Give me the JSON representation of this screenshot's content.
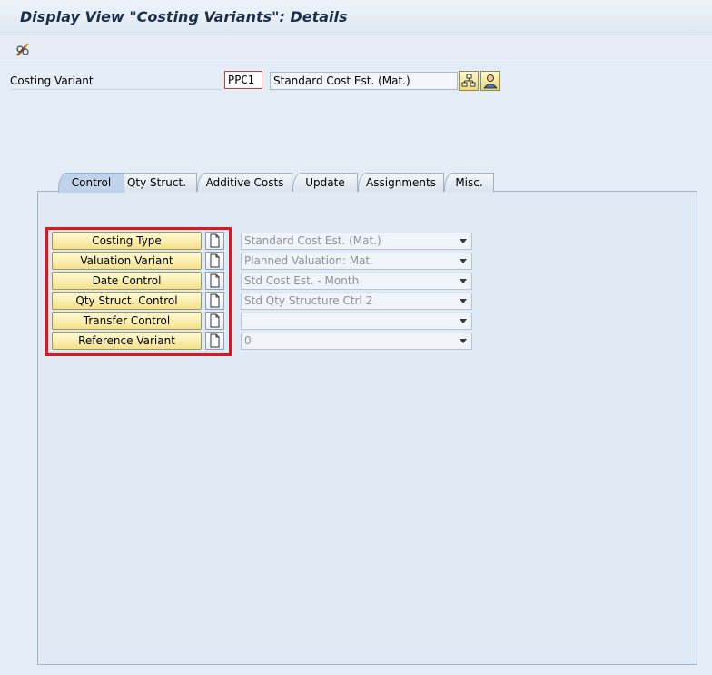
{
  "window": {
    "title": "Display View \"Costing Variants\": Details"
  },
  "toolbar": {
    "edit_icon": "pencil-glasses-icon"
  },
  "header": {
    "costing_variant_label": "Costing Variant",
    "costing_variant_key": "PPC1",
    "costing_variant_desc": "Standard Cost Est. (Mat.)",
    "icons": [
      "hierarchy-icon",
      "person-icon"
    ]
  },
  "tabs": [
    {
      "label": "Control",
      "active": true
    },
    {
      "label": "Qty Struct."
    },
    {
      "label": "Additive Costs"
    },
    {
      "label": "Update"
    },
    {
      "label": "Assignments"
    },
    {
      "label": "Misc."
    }
  ],
  "control_rows": [
    {
      "button": "Costing Type",
      "value": "Standard Cost Est. (Mat.)"
    },
    {
      "button": "Valuation Variant",
      "value": "Planned Valuation: Mat."
    },
    {
      "button": "Date Control",
      "value": "Std Cost Est. - Month"
    },
    {
      "button": "Qty Struct. Control",
      "value": "Std Qty Structure Ctrl 2"
    },
    {
      "button": "Transfer Control",
      "value": ""
    },
    {
      "button": "Reference Variant",
      "value": "0"
    }
  ],
  "colors": {
    "highlight": "#e3141e",
    "title": "#1b2f4a",
    "button": "#f5e08a"
  }
}
